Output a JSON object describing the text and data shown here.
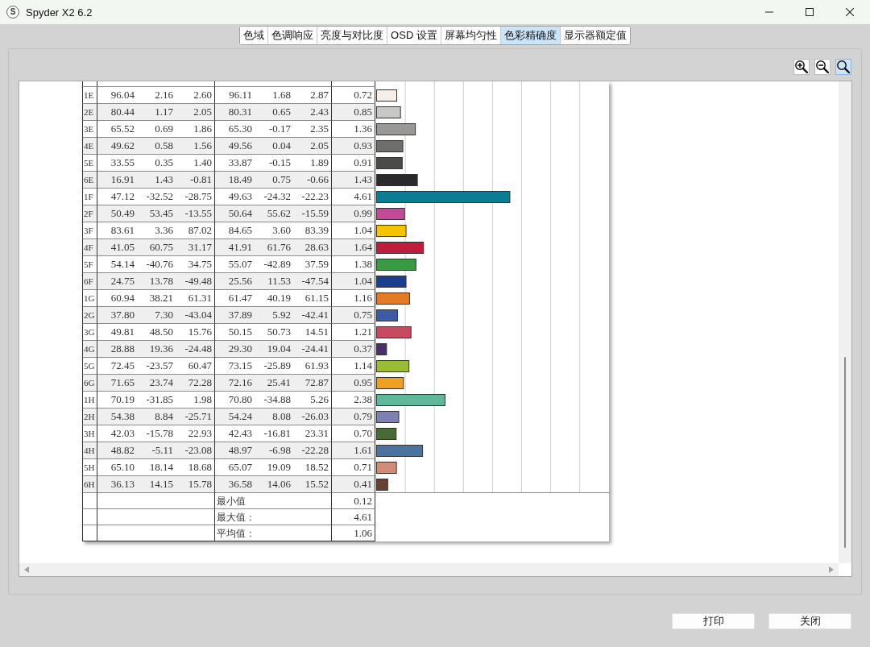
{
  "window": {
    "icon_letter": "S",
    "title": "Spyder X2 6.2"
  },
  "tabs": [
    {
      "label": "色域",
      "selected": false
    },
    {
      "label": "色调响应",
      "selected": false
    },
    {
      "label": "亮度与对比度",
      "selected": false
    },
    {
      "label": "OSD 设置",
      "selected": false
    },
    {
      "label": "屏幕均匀性",
      "selected": false
    },
    {
      "label": "色彩精确度",
      "selected": true
    },
    {
      "label": "显示器额定值",
      "selected": false
    }
  ],
  "zoom_tools": [
    {
      "kind": "zoom-in",
      "selected": false
    },
    {
      "kind": "zoom-out",
      "selected": false
    },
    {
      "kind": "zoom-fit",
      "selected": true
    }
  ],
  "report": {
    "rows": [
      {
        "cells": [
          "1E",
          "96.04",
          "2.16",
          "2.60",
          "96.11",
          "1.68",
          "2.87",
          "0.72"
        ],
        "color": "#f6efe8"
      },
      {
        "cells": [
          "2E",
          "80.44",
          "1.17",
          "2.05",
          "80.31",
          "0.65",
          "2.43",
          "0.85"
        ],
        "color": "#c8c8c6"
      },
      {
        "cells": [
          "3E",
          "65.52",
          "0.69",
          "1.86",
          "65.30",
          "-0.17",
          "2.35",
          "1.36"
        ],
        "color": "#999896"
      },
      {
        "cells": [
          "4E",
          "49.62",
          "0.58",
          "1.56",
          "49.56",
          "0.04",
          "2.05",
          "0.93"
        ],
        "color": "#6e6e6c"
      },
      {
        "cells": [
          "5E",
          "33.55",
          "0.35",
          "1.40",
          "33.87",
          "-0.15",
          "1.89",
          "0.91"
        ],
        "color": "#4a4a49"
      },
      {
        "cells": [
          "6E",
          "16.91",
          "1.43",
          "-0.81",
          "18.49",
          "0.75",
          "-0.66",
          "1.43"
        ],
        "color": "#2a2a2a"
      },
      {
        "cells": [
          "1F",
          "47.12",
          "-32.52",
          "-28.75",
          "49.63",
          "-24.32",
          "-22.23",
          "4.61"
        ],
        "color": "#0a7d94"
      },
      {
        "cells": [
          "2F",
          "50.49",
          "53.45",
          "-13.55",
          "50.64",
          "55.62",
          "-15.59",
          "0.99"
        ],
        "color": "#c24b98"
      },
      {
        "cells": [
          "3F",
          "83.61",
          "3.36",
          "87.02",
          "84.65",
          "3.60",
          "83.39",
          "1.04"
        ],
        "color": "#f5c400"
      },
      {
        "cells": [
          "4F",
          "41.05",
          "60.75",
          "31.17",
          "41.91",
          "61.76",
          "28.63",
          "1.64"
        ],
        "color": "#be1e3c"
      },
      {
        "cells": [
          "5F",
          "54.14",
          "-40.76",
          "34.75",
          "55.07",
          "-42.89",
          "37.59",
          "1.38"
        ],
        "color": "#3a9a44"
      },
      {
        "cells": [
          "6F",
          "24.75",
          "13.78",
          "-49.48",
          "25.56",
          "11.53",
          "-47.54",
          "1.04"
        ],
        "color": "#1a3f8f"
      },
      {
        "cells": [
          "1G",
          "60.94",
          "38.21",
          "61.31",
          "61.47",
          "40.19",
          "61.15",
          "1.16"
        ],
        "color": "#e57a25"
      },
      {
        "cells": [
          "2G",
          "37.80",
          "7.30",
          "-43.04",
          "37.89",
          "5.92",
          "-42.41",
          "0.75"
        ],
        "color": "#3c5aa6"
      },
      {
        "cells": [
          "3G",
          "49.81",
          "48.50",
          "15.76",
          "50.15",
          "50.73",
          "14.51",
          "1.21"
        ],
        "color": "#c84a60"
      },
      {
        "cells": [
          "4G",
          "28.88",
          "19.36",
          "-24.48",
          "29.30",
          "19.04",
          "-24.41",
          "0.37"
        ],
        "color": "#4b2f6b"
      },
      {
        "cells": [
          "5G",
          "72.45",
          "-23.57",
          "60.47",
          "73.15",
          "-25.89",
          "61.93",
          "1.14"
        ],
        "color": "#9abc32"
      },
      {
        "cells": [
          "6G",
          "71.65",
          "23.74",
          "72.28",
          "72.16",
          "25.41",
          "72.87",
          "0.95"
        ],
        "color": "#f0a020"
      },
      {
        "cells": [
          "1H",
          "70.19",
          "-31.85",
          "1.98",
          "70.80",
          "-34.88",
          "5.26",
          "2.38"
        ],
        "color": "#5fb89a"
      },
      {
        "cells": [
          "2H",
          "54.38",
          "8.84",
          "-25.71",
          "54.24",
          "8.08",
          "-26.03",
          "0.79"
        ],
        "color": "#7c80b2"
      },
      {
        "cells": [
          "3H",
          "42.03",
          "-15.78",
          "22.93",
          "42.43",
          "-16.81",
          "23.31",
          "0.70"
        ],
        "color": "#4a6a34"
      },
      {
        "cells": [
          "4H",
          "48.82",
          "-5.11",
          "-23.08",
          "48.97",
          "-6.98",
          "-22.28",
          "1.61"
        ],
        "color": "#4a73a0"
      },
      {
        "cells": [
          "5H",
          "65.10",
          "18.14",
          "18.68",
          "65.07",
          "19.09",
          "18.52",
          "0.71"
        ],
        "color": "#d08c78"
      },
      {
        "cells": [
          "6H",
          "36.13",
          "14.15",
          "15.78",
          "36.58",
          "14.06",
          "15.52",
          "0.41"
        ],
        "color": "#6a4030"
      }
    ],
    "summary": [
      {
        "label": "最小值",
        "value": "0.12"
      },
      {
        "label": "最大值：",
        "value": "4.61"
      },
      {
        "label": "平均值：",
        "value": "1.06"
      }
    ]
  },
  "buttons": [
    "打印",
    "关闭"
  ]
}
